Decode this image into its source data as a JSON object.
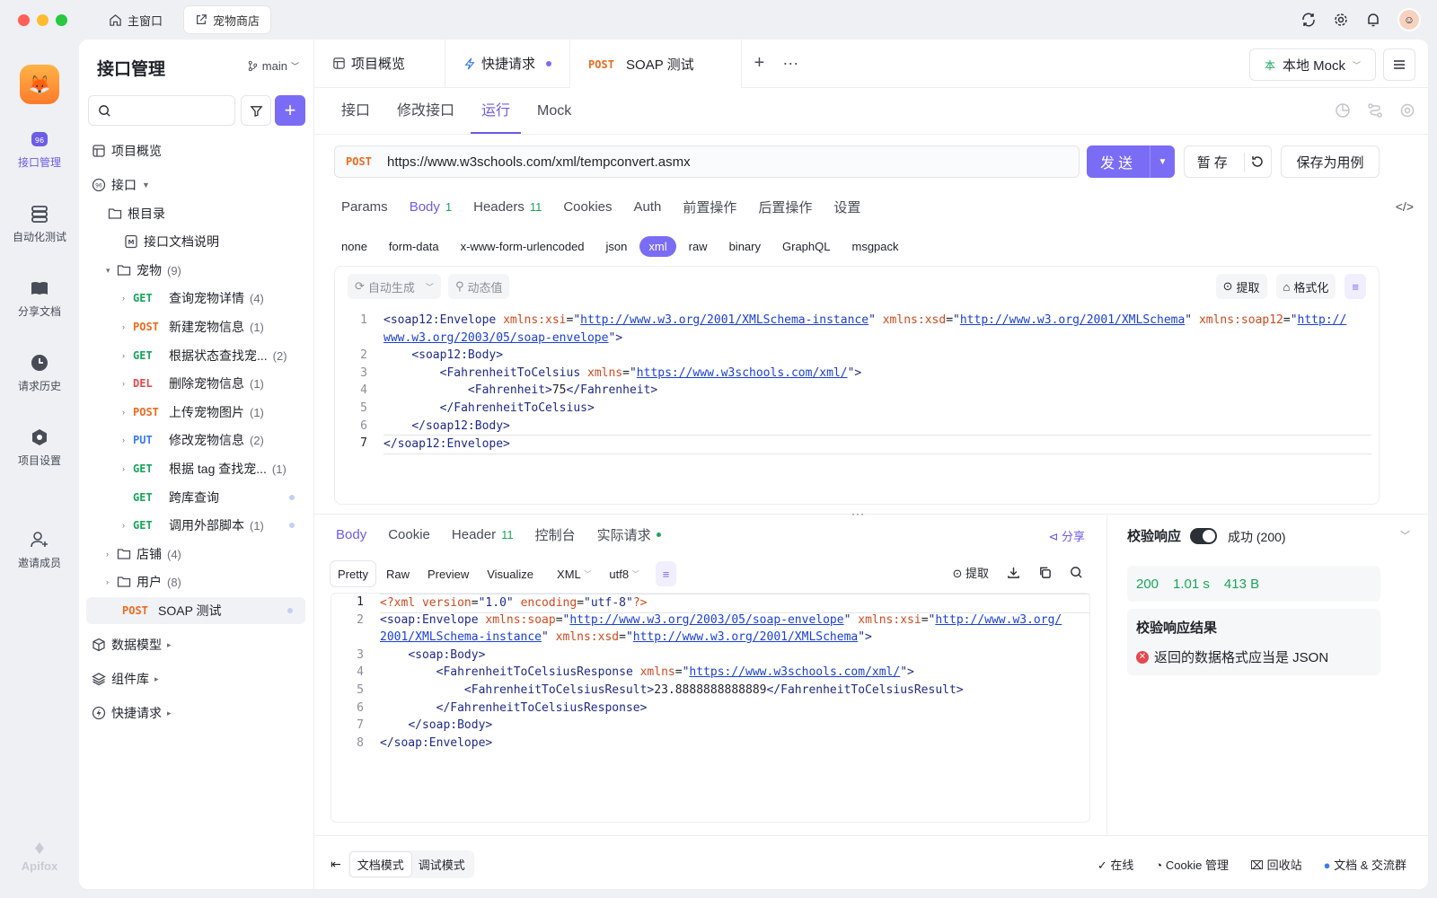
{
  "titlebar": {
    "tabs": [
      {
        "label": "主窗口"
      },
      {
        "label": "宠物商店"
      }
    ]
  },
  "rail": {
    "items": [
      {
        "label": "接口管理"
      },
      {
        "label": "自动化测试"
      },
      {
        "label": "分享文档"
      },
      {
        "label": "请求历史"
      },
      {
        "label": "项目设置"
      },
      {
        "label": "邀请成员"
      }
    ],
    "footer": "Apifox"
  },
  "tree": {
    "title": "接口管理",
    "branch": "main",
    "nodes": [
      {
        "label": "项目概览"
      },
      {
        "label": "接口"
      },
      {
        "label": "根目录"
      },
      {
        "label": "接口文档说明"
      },
      {
        "label": "宠物",
        "count": "(9)"
      },
      {
        "method": "GET",
        "label": "查询宠物详情",
        "count": "(4)"
      },
      {
        "method": "POST",
        "label": "新建宠物信息",
        "count": "(1)"
      },
      {
        "method": "GET",
        "label": "根据状态查找宠...",
        "count": "(2)"
      },
      {
        "method": "DEL",
        "label": "删除宠物信息",
        "count": "(1)"
      },
      {
        "method": "POST",
        "label": "上传宠物图片",
        "count": "(1)"
      },
      {
        "method": "PUT",
        "label": "修改宠物信息",
        "count": "(2)"
      },
      {
        "method": "GET",
        "label": "根据 tag 查找宠...",
        "count": "(1)"
      },
      {
        "method": "GET",
        "label": "跨库查询",
        "count": ""
      },
      {
        "method": "GET",
        "label": "调用外部脚本",
        "count": "(1)"
      },
      {
        "label": "店铺",
        "count": "(4)"
      },
      {
        "label": "用户",
        "count": "(8)"
      },
      {
        "method": "POST",
        "label": "SOAP 测试",
        "count": ""
      },
      {
        "label": "数据模型"
      },
      {
        "label": "组件库"
      },
      {
        "label": "快捷请求"
      }
    ]
  },
  "tabs": {
    "items": [
      {
        "label": "项目概览"
      },
      {
        "label": "快捷请求"
      },
      {
        "method": "POST",
        "label": "SOAP 测试"
      }
    ],
    "env": "本地 Mock",
    "env_badge": "本"
  },
  "subtabs": [
    "接口",
    "修改接口",
    "运行",
    "Mock"
  ],
  "request": {
    "method": "POST",
    "url": "https://www.w3schools.com/xml/tempconvert.asmx",
    "send": "发送",
    "stash": "暂存",
    "save_case": "保存为用例"
  },
  "param_tabs": [
    {
      "label": "Params",
      "n": ""
    },
    {
      "label": "Body",
      "n": "1"
    },
    {
      "label": "Headers",
      "n": "11"
    },
    {
      "label": "Cookies",
      "n": ""
    },
    {
      "label": "Auth",
      "n": ""
    },
    {
      "label": "前置操作",
      "n": ""
    },
    {
      "label": "后置操作",
      "n": ""
    },
    {
      "label": "设置",
      "n": ""
    }
  ],
  "body_types": [
    "none",
    "form-data",
    "x-www-form-urlencoded",
    "json",
    "xml",
    "raw",
    "binary",
    "GraphQL",
    "msgpack"
  ],
  "editor": {
    "auto_gen": "自动生成",
    "dynamic": "动态值",
    "extract": "提取",
    "format": "格式化"
  },
  "response": {
    "tabs": [
      {
        "label": "Body",
        "n": ""
      },
      {
        "label": "Cookie",
        "n": ""
      },
      {
        "label": "Header",
        "n": "11"
      },
      {
        "label": "控制台",
        "n": ""
      },
      {
        "label": "实际请求",
        "n": ""
      }
    ],
    "share": "分享",
    "views": [
      "Pretty",
      "Raw",
      "Preview",
      "Visualize"
    ],
    "lang": "XML",
    "encoding": "utf8",
    "extract": "提取"
  },
  "validate": {
    "title": "校验响应",
    "status": "成功 (200)",
    "code": "200",
    "time": "1.01 s",
    "size": "413 B",
    "result_title": "校验响应结果",
    "error": "返回的数据格式应当是 JSON"
  },
  "footer": {
    "modes": [
      "文档模式",
      "调试模式"
    ],
    "links": [
      "在线",
      "Cookie 管理",
      "回收站",
      "文档 & 交流群"
    ]
  },
  "colors": {
    "accent": "#7b6cf6",
    "get": "#1aa55c",
    "post": "#f06a1e",
    "del": "#e5484d",
    "put": "#3a7bf0"
  }
}
